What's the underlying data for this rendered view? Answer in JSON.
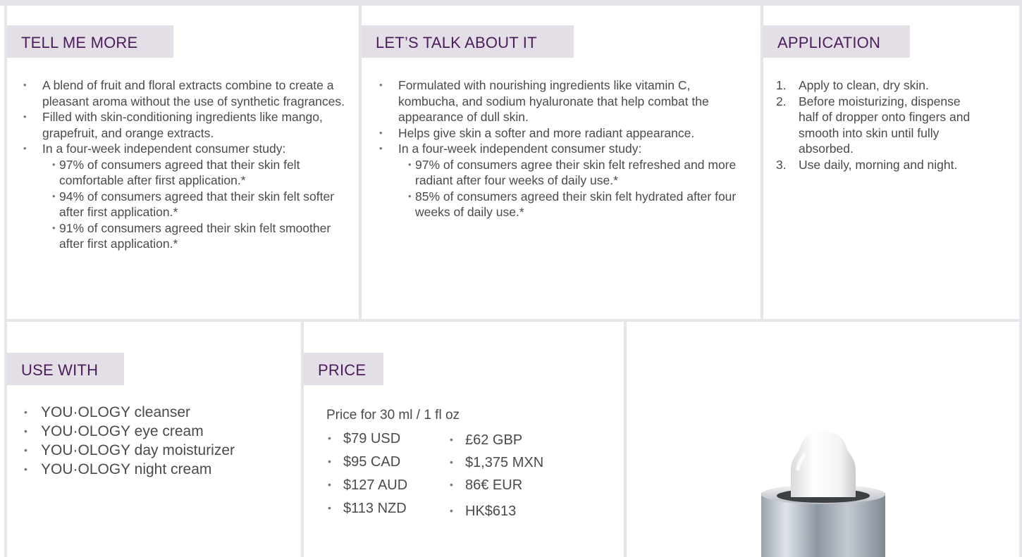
{
  "tell_me_more": {
    "title": "TELL ME MORE",
    "items": [
      "A blend of fruit and floral extracts combine to create a pleasant aroma without the use of synthetic fragrances.",
      "Filled with skin-conditioning ingredients like mango, grapefruit, and orange extracts.",
      "In a four-week independent consumer study:"
    ],
    "subitems": [
      "97% of consumers agreed that their skin felt comfortable after first application.*",
      "94% of consumers agreed that their skin felt softer after first application.*",
      "91% of consumers agreed their skin felt smoother after first application.*"
    ]
  },
  "lets_talk": {
    "title": "LET’S TALK ABOUT IT",
    "items": [
      "Formulated with nourishing ingredients like vitamin C, kombucha, and sodium hyaluronate that help combat the appearance of dull skin.",
      "Helps give skin a softer and more radiant appearance.",
      "In a four-week independent consumer study:"
    ],
    "subitems": [
      "97% of consumers agree their skin felt refreshed and more radiant after four weeks of daily use.*",
      "85% of consumers agreed their skin felt hydrated after four weeks of daily use.*"
    ]
  },
  "application": {
    "title": "APPLICATION",
    "steps": [
      {
        "num": "1.",
        "text": "Apply to clean, dry skin."
      },
      {
        "num": "2.",
        "text": "Before moisturizing, dispense half of dropper onto fingers and smooth into skin until fully absorbed."
      },
      {
        "num": "3.",
        "text": "Use daily, morning and night."
      }
    ]
  },
  "use_with": {
    "title": "USE WITH",
    "items": [
      "YOU·OLOGY cleanser",
      "YOU·OLOGY eye cream",
      "YOU·OLOGY day moisturizer",
      "YOU·OLOGY night cream"
    ]
  },
  "price": {
    "title": "PRICE",
    "note": "Price for 30 ml / 1 fl oz",
    "col1": [
      "$79 USD",
      "$95 CAD",
      "$127 AUD",
      "$113 NZD"
    ],
    "col2": [
      "£62 GBP",
      "$1,375 MXN",
      "86€ EUR",
      "HK$613"
    ]
  },
  "colors": {
    "tab_bg": "#e4dfe6",
    "tab_text": "#4c1d5c",
    "divider": "#e7e4ea",
    "body_text": "#4a4a4a"
  },
  "icons": {
    "product": "dropper-bottle-image"
  }
}
